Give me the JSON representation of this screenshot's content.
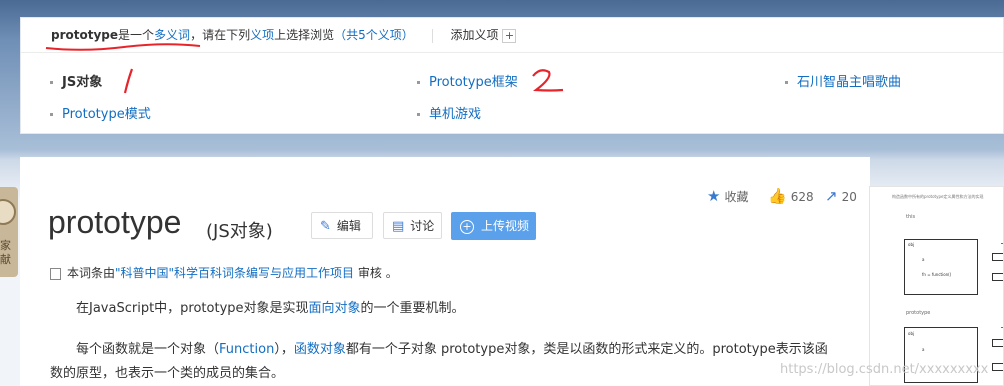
{
  "polysemy": {
    "term": "prototype",
    "is_a": "是一个",
    "polysemous_link": "多义词",
    "instruction_pre": "，请在下列",
    "sense_link": "义项",
    "instruction_post": "上选择浏览",
    "count_open": "（",
    "count_link": "共5个义项",
    "count_close": "）",
    "add_sense": "添加义项",
    "add_icon": "+"
  },
  "senses": [
    {
      "label": "JS对象",
      "current": true
    },
    {
      "label": "Prototype框架",
      "current": false
    },
    {
      "label": "石川智晶主唱歌曲",
      "current": false
    },
    {
      "label": "Prototype模式",
      "current": false
    },
    {
      "label": "单机游戏",
      "current": false
    }
  ],
  "annotations": {
    "mark1": "1",
    "mark2": "2"
  },
  "side_tab": {
    "text": "家\n献"
  },
  "lemma": {
    "title": "prototype",
    "subtitle": "(JS对象)"
  },
  "toolbar": {
    "edit_label": "编辑",
    "discuss_label": "讨论",
    "upload_label": "上传视频"
  },
  "stats": {
    "favorite_label": "收藏",
    "likes": "628",
    "shares": "20"
  },
  "review": {
    "pre": "本词条由",
    "link": "\"科普中国\"科学百科词条编写与应用工作项目",
    "post": " 审核 。"
  },
  "paragraphs": {
    "p1_pre": "在JavaScript中，prototype对象是实现",
    "p1_link": "面向对象",
    "p1_post": "的一个重要机制。",
    "p2_pre": "每个函数就是一个对象（",
    "p2_link1": "Function",
    "p2_mid": "），",
    "p2_link2": "函数对象",
    "p2_post": "都有一个子对象 prototype对象，类是以函数的形式来定义的。prototype表示该函数的原型，也表示一个类的成员的集合。"
  },
  "thumbnail": {
    "caption": "构造函数中所有的prototype定义属性和方法的实现",
    "label_this": "this",
    "label_obj": "obj",
    "label_a": "a",
    "label_fn": "fn = function()",
    "label_prototype": "prototype",
    "label_obj2": "obj"
  },
  "watermark": "https://blog.csdn.net/xxxxxxxxx",
  "colors": {
    "link": "#136ec2",
    "annotation": "#e8242b",
    "upload_button": "#5aa0ea"
  }
}
